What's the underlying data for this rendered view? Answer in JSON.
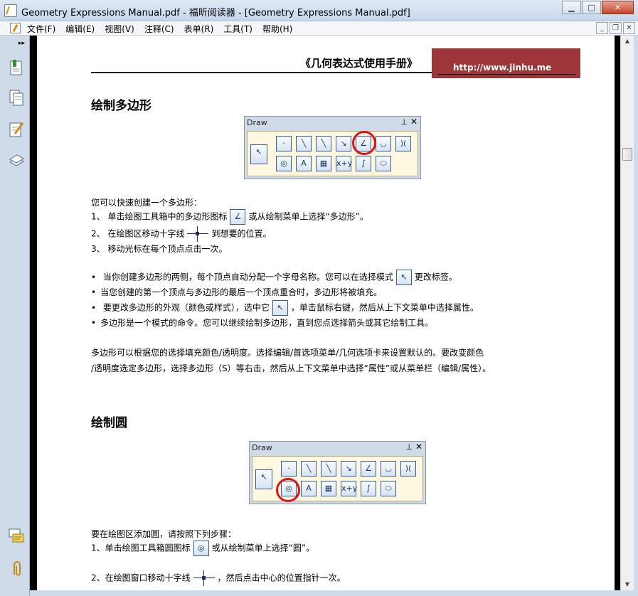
{
  "window": {
    "title": "Geometry Expressions Manual.pdf - 福昕阅读器 - [Geometry Expressions Manual.pdf]",
    "minimize": "▁",
    "maximize": "□",
    "close": "✕"
  },
  "menu": {
    "items": [
      "文件(F)",
      "编辑(E)",
      "视图(V)",
      "注释(C)",
      "表单(R)",
      "工具(T)",
      "帮助(H)"
    ],
    "mdi_minimize": "_",
    "mdi_restore": "❐",
    "mdi_close": "✕"
  },
  "left_panel": {
    "expand_glyph": "▸▸"
  },
  "page": {
    "header_title": "《几何表达式使用手册》",
    "header_url": "http://www.jinhu.me",
    "section1": {
      "heading": "绘制多边形",
      "toolbox_title": "Draw",
      "intro": "您可以快速创建一个多边形：",
      "step1_a": "1、 单击绘图工具箱中的多边形图标",
      "step1_b": "或从绘制菜单上选择“多边形”。",
      "step2_a": "2、 在绘图区移动十字线",
      "step2_b": "到想要的位置。",
      "step3": "3、 移动光标在每个顶点点击一次。",
      "bullet1_a": "当你创建多边形的两侧，每个顶点自动分配一个字母名称。您可以在选择模式",
      "bullet1_b": "更改标签。",
      "bullet2": "当您创建的第一个顶点与多边形的最后一个顶点重合时，多边形将被填充。",
      "bullet3_a": "要更改多边形的外观（颜色或样式），选中它",
      "bullet3_b": "，单击鼠标右键，然后从上下文菜单中选择属性。",
      "bullet4": "多边形是一个模式的命令。您可以继续绘制多边形，直到您点选择箭头或其它绘制工具。",
      "para1": "多边形可以根据您的选择填充颜色/透明度。选择编辑/首选项菜单/几何选项卡来设置默认的。要改变颜色",
      "para2": "/透明度选定多边形，选择多边形（S）等右击，然后从上下文菜单中选择“属性”或从菜单栏（编辑/属性）。"
    },
    "section2": {
      "heading": "绘制圆",
      "toolbox_title": "Draw",
      "intro": "要在绘图区添加圆，请按照下列步骤：",
      "step1_a": "1、单击绘图工具箱圆图标",
      "step1_b": "或从绘制菜单上选择“圆”。",
      "step2_a": "2、在绘图窗口移动十字线",
      "step2_b": "，然后点击中心的位置指针一次。"
    },
    "tool_glyphs": {
      "select": "↖",
      "point": "·",
      "segment": "╲",
      "line": "╲",
      "ray": "↘",
      "polygon": "∠",
      "arc": "◡",
      "hyperbola": ")(",
      "circle": "◎",
      "text": "A",
      "image": "▦",
      "expression": "x+y",
      "curve": "∫",
      "ellipse": "⬭"
    }
  }
}
